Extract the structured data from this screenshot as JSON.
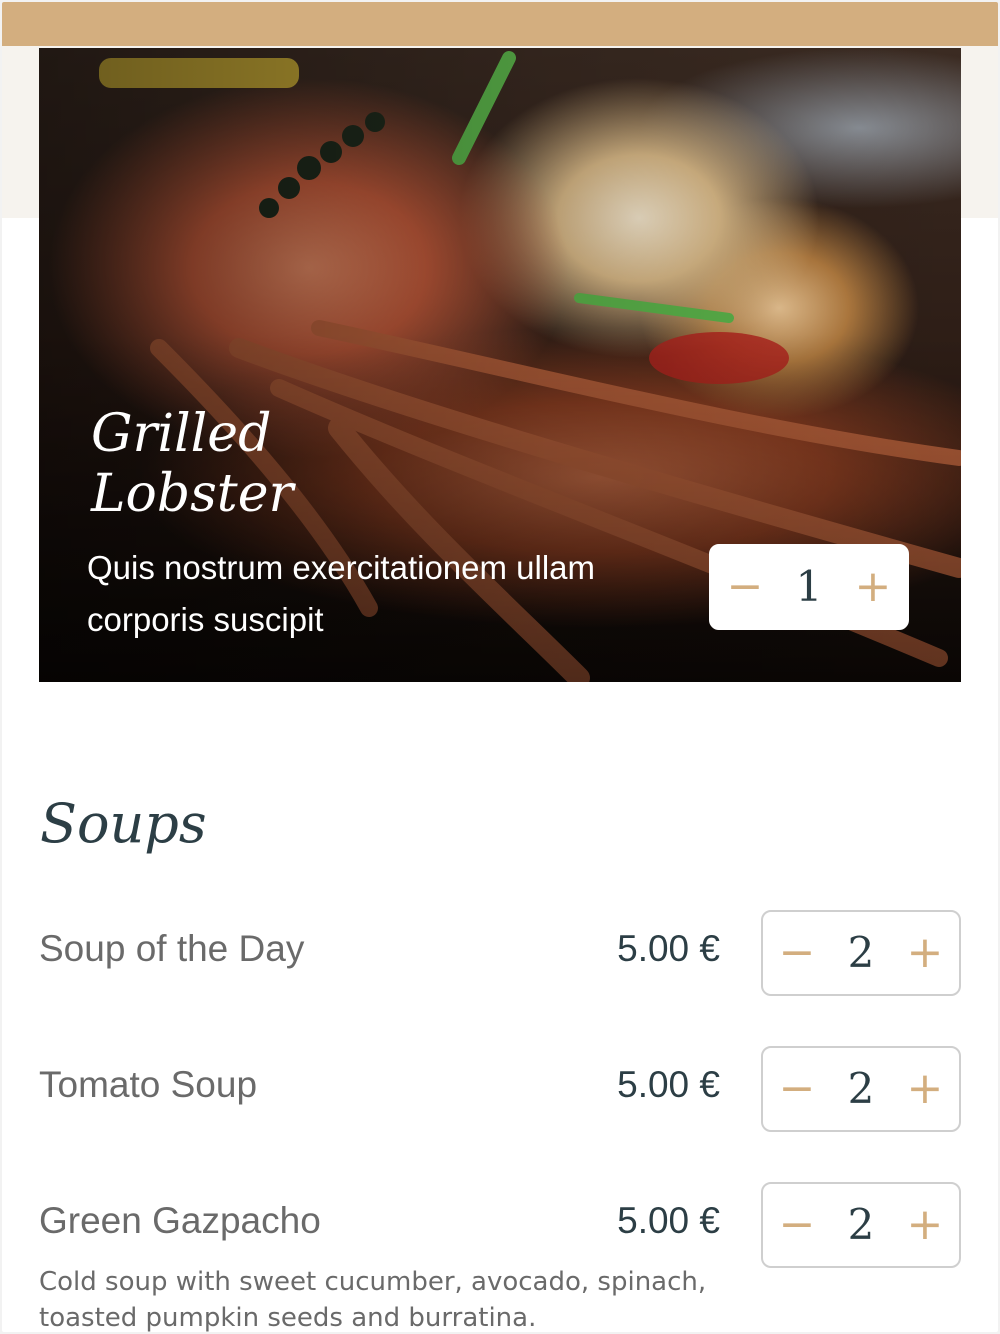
{
  "colors": {
    "accent": "#d3ae7f",
    "dark_text": "#2c3e45",
    "muted_text": "#6a6a6a",
    "cream": "#f6f3ee"
  },
  "featured": {
    "title": "Grilled Lobster",
    "description": "Quis nostrum exercitationem ullam corporis suscipit",
    "quantity": "1",
    "minus_symbol": "−",
    "plus_symbol": "+"
  },
  "section": {
    "title": "Soups"
  },
  "items": [
    {
      "name": "Soup of the Day",
      "price": "5.00 €",
      "quantity": "2"
    },
    {
      "name": "Tomato Soup",
      "price": "5.00 €",
      "quantity": "2"
    },
    {
      "name": "Green Gazpacho",
      "price": "5.00 €",
      "quantity": "2",
      "description": "Cold soup with sweet cucumber, avocado, spinach, toasted pumpkin seeds and burratina."
    }
  ],
  "icons": {
    "decrement": "minus-icon",
    "increment": "plus-icon"
  }
}
